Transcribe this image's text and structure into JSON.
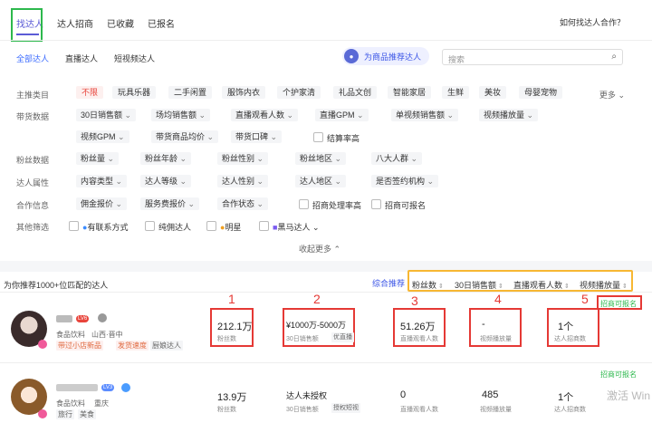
{
  "topnav": {
    "tabs": [
      "找达人",
      "达人招商",
      "已收藏",
      "已报名"
    ],
    "help": "如何找达人合作？"
  },
  "subtabs": [
    "全部达人",
    "直播达人",
    "短视频达人"
  ],
  "recommend_btn": "为商品推荐达人",
  "search": {
    "placeholder": "搜索"
  },
  "filters": {
    "main_category": {
      "label": "主推类目",
      "items": [
        "不限",
        "玩具乐器",
        "二手闲置",
        "服饰内衣",
        "个护家清",
        "礼品文创",
        "智能家居",
        "生鲜",
        "美妆",
        "母婴宠物"
      ],
      "more": "更多"
    },
    "sales_data": {
      "label": "带货数据",
      "dropdowns": [
        "30日销售额",
        "场均销售额",
        "直播观看人数",
        "直播GPM",
        "单视频销售额",
        "视频播放量",
        "视频GPM",
        "带货商品均价",
        "带货口碑"
      ],
      "checkbox": "结算率高"
    },
    "fans_data": {
      "label": "粉丝数据",
      "dropdowns": [
        "粉丝量",
        "粉丝年龄",
        "粉丝性别",
        "粉丝地区",
        "八大人群"
      ]
    },
    "talent_attr": {
      "label": "达人属性",
      "dropdowns": [
        "内容类型",
        "达人等级",
        "达人性别",
        "达人地区",
        "是否签约机构"
      ]
    },
    "coop_info": {
      "label": "合作信息",
      "dropdowns": [
        "佣金报价",
        "服务费报价",
        "合作状态"
      ],
      "checkboxes": [
        "招商处理率高",
        "招商可报名"
      ]
    },
    "other": {
      "label": "其他筛选",
      "checkboxes": [
        "有联系方式",
        "纯佣达人",
        "明星",
        "黑马达人"
      ]
    },
    "collapse": "收起更多"
  },
  "results": {
    "count_text": "为你推荐1000+位匹配的达人",
    "sort": [
      "综合推荐",
      "粉丝数",
      "30日销售额",
      "直播观看人数",
      "视频播放量"
    ]
  },
  "talents": [
    {
      "level": "LV6",
      "category": "食品饮料",
      "location": "山西·晋中",
      "tags": [
        "带过小店新品",
        "发货速度",
        "厨娘达人"
      ],
      "status": "招商可报名",
      "metrics": [
        {
          "value": "212.1万",
          "label": "粉丝数"
        },
        {
          "value": "¥1000万-5000万",
          "label": "30日销售额",
          "tag": "优直播"
        },
        {
          "value": "51.26万",
          "label": "直播观看人数"
        },
        {
          "value": "-",
          "label": "视频播放量"
        },
        {
          "value": "1个",
          "label": "达人招商数"
        }
      ]
    },
    {
      "level": "LV3",
      "category": "食品饮料",
      "location": "重庆",
      "tags": [
        "旅行",
        "美食"
      ],
      "status": "招商可报名",
      "metrics": [
        {
          "value": "13.9万",
          "label": "粉丝数"
        },
        {
          "value": "达人未授权",
          "label": "30日销售额",
          "tag": "授权短视"
        },
        {
          "value": "0",
          "label": "直播观看人数"
        },
        {
          "value": "485",
          "label": "视频播放量"
        },
        {
          "value": "1个",
          "label": "达人招商数"
        }
      ]
    }
  ],
  "annotations": [
    "1",
    "2",
    "3",
    "4",
    "5"
  ],
  "watermark": "激活 Win"
}
